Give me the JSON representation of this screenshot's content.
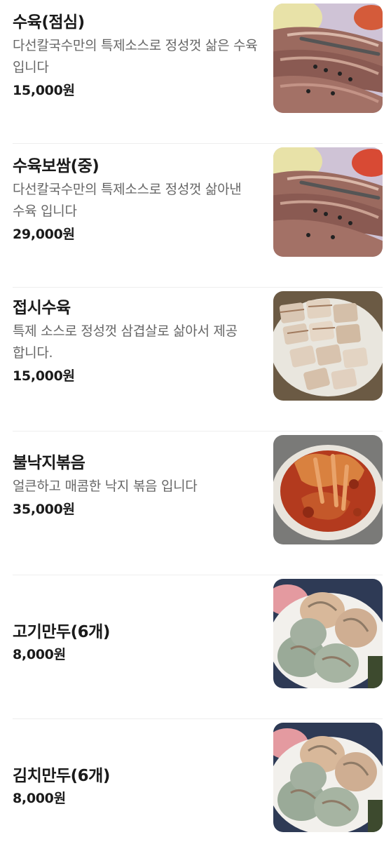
{
  "menu": {
    "items": [
      {
        "name": "수육(점심)",
        "description": "다선칼국수만의 특제소스로 정성껏 삶은 수육 입니다",
        "price": "15,000원",
        "image_icon": "boiled-pork-photo"
      },
      {
        "name": "수육보쌈(중)",
        "description": "다선칼국수만의 특제소스로 정성껏 삶아낸 수육 입니다",
        "price": "29,000원",
        "image_icon": "boiled-pork-wrap-photo"
      },
      {
        "name": "접시수육",
        "description": "특제 소스로 정성껏 삼겹살로 삶아서 제공 합니다.",
        "price": "15,000원",
        "image_icon": "plated-pork-belly-photo"
      },
      {
        "name": "불낙지볶음",
        "description": "얼큰하고 매콤한 낙지 볶음 입니다",
        "price": "35,000원",
        "image_icon": "spicy-octopus-photo"
      },
      {
        "name": "고기만두(6개)",
        "description": "",
        "price": "8,000원",
        "image_icon": "meat-dumpling-photo"
      },
      {
        "name": "김치만두(6개)",
        "description": "",
        "price": "8,000원",
        "image_icon": "kimchi-dumpling-photo"
      }
    ]
  },
  "colors": {
    "title_text": "#1a1a1a",
    "description_text": "#666666",
    "divider": "#eeeeee",
    "background": "#ffffff"
  }
}
